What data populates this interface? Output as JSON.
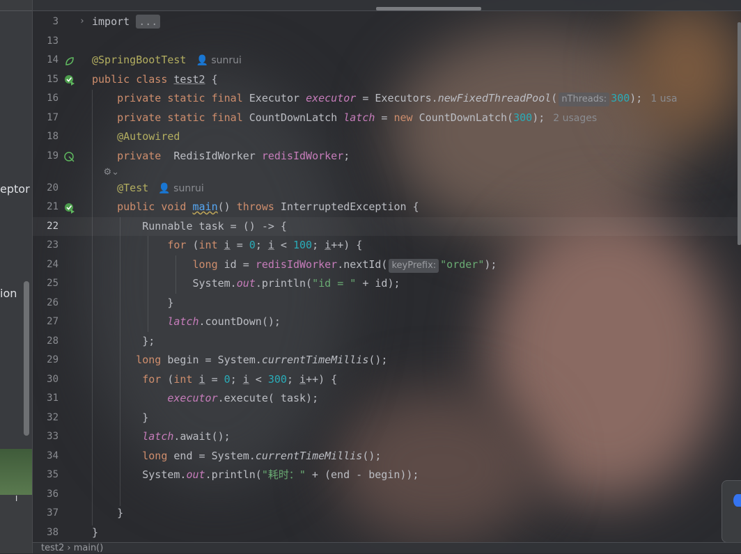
{
  "left_panel": {
    "item_a": "eptor",
    "item_b": "ion",
    "item_c": "I"
  },
  "breadcrumb": {
    "text": "test2 › main()"
  },
  "hints": {
    "nthreads": "nThreads:",
    "keyprefix": "keyPrefix:",
    "usages_1": "1 usa",
    "usages_2": "2 usages",
    "author": "sunrui"
  },
  "lines": [
    {
      "n": "3"
    },
    {
      "n": "13"
    },
    {
      "n": "14"
    },
    {
      "n": "15"
    },
    {
      "n": "16"
    },
    {
      "n": "17"
    },
    {
      "n": "18"
    },
    {
      "n": "19"
    },
    {
      "n": "20"
    },
    {
      "n": "21"
    },
    {
      "n": "22"
    },
    {
      "n": "23"
    },
    {
      "n": "24"
    },
    {
      "n": "25"
    },
    {
      "n": "26"
    },
    {
      "n": "27"
    },
    {
      "n": "28"
    },
    {
      "n": "29"
    },
    {
      "n": "30"
    },
    {
      "n": "31"
    },
    {
      "n": "32"
    },
    {
      "n": "33"
    },
    {
      "n": "34"
    },
    {
      "n": "35"
    },
    {
      "n": "36"
    },
    {
      "n": "37"
    },
    {
      "n": "38"
    }
  ],
  "code": {
    "l3_import": "import",
    "l3_dots": "...",
    "l14_ann": "@SpringBootTest",
    "l15_a": "public class",
    "l15_b": "test2",
    "l15_c": " {",
    "l16_a": "private static final",
    "l16_b": " Executor ",
    "l16_c": "executor",
    "l16_d": " = Executors.",
    "l16_e": "newFixedThreadPool",
    "l16_f": "(",
    "l16_g": "300",
    "l16_h": ");",
    "l17_a": "private static final",
    "l17_b": " CountDownLatch ",
    "l17_c": "latch",
    "l17_d": " = ",
    "l17_e": "new",
    "l17_f": " CountDownLatch(",
    "l17_g": "300",
    "l17_h": ");",
    "l18_ann": "@Autowired",
    "l19_a": "private",
    "l19_b": "  RedisIdWorker ",
    "l19_c": "redisIdWorker",
    "l19_d": ";",
    "l20_ann": "@Test",
    "l21_a": "public void",
    "l21_b": "main",
    "l21_c": "() ",
    "l21_d": "throws",
    "l21_e": " InterruptedException {",
    "l22": "Runnable task = () -> {",
    "l23_a": "for",
    "l23_b": " (",
    "l23_c": "int",
    "l23_d": "i",
    "l23_e": " = ",
    "l23_f": "0",
    "l23_g": "; ",
    "l23_h": "i",
    "l23_i": " < ",
    "l23_j": "100",
    "l23_k": "; ",
    "l23_l": "i",
    "l23_m": "++) {",
    "l24_a": "long",
    "l24_b": " id = ",
    "l24_c": "redisIdWorker",
    "l24_d": ".nextId(",
    "l24_e": "\"order\"",
    "l24_f": ");",
    "l25_a": "System.",
    "l25_b": "out",
    "l25_c": ".println(",
    "l25_d": "\"id = \"",
    "l25_e": " + id);",
    "l26": "}",
    "l27_a": "latch",
    "l27_b": ".countDown();",
    "l28": "};",
    "l29_a": "long",
    "l29_b": " begin = System.",
    "l29_c": "currentTimeMillis",
    "l29_d": "();",
    "l30_a": "for",
    "l30_b": " (",
    "l30_c": "int",
    "l30_d": "i",
    "l30_e": " = ",
    "l30_f": "0",
    "l30_g": "; ",
    "l30_h": "i",
    "l30_i": " < ",
    "l30_j": "300",
    "l30_k": "; ",
    "l30_l": "i",
    "l30_m": "++) {",
    "l31_a": "executor",
    "l31_b": ".execute( task);",
    "l32": "}",
    "l33_a": "latch",
    "l33_b": ".await();",
    "l34_a": "long",
    "l34_b": " end = System.",
    "l34_c": "currentTimeMillis",
    "l34_d": "();",
    "l35_a": "System.",
    "l35_b": "out",
    "l35_c": ".println(",
    "l35_d": "\"耗时：\"",
    "l35_e": " + (end - begin));",
    "l37": "}",
    "l38": "}"
  },
  "colors": {
    "keyword": "#cf8e6d",
    "annotation": "#b3ae60",
    "field": "#c77dbb",
    "number": "#2aacb8",
    "string": "#6aab73"
  }
}
